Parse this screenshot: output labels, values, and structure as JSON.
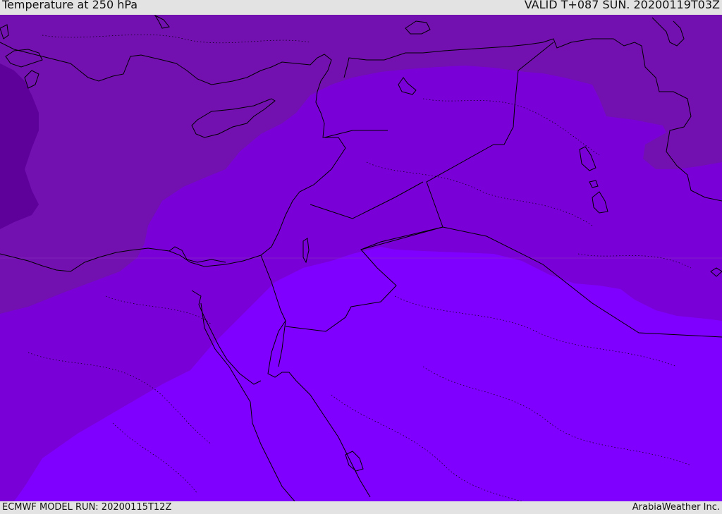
{
  "header": {
    "title": "Temperature at 250 hPa",
    "valid_time": "VALID T+087 SUN. 20200119T03Z"
  },
  "footer": {
    "model_run": "ECMWF MODEL RUN: 20200115T12Z",
    "credit": "ArabiaWeather Inc."
  },
  "colors": {
    "band_darkest": "#5e009a",
    "band_dark": "#7210b0",
    "band_mid": "#7a00d8",
    "band_light": "#7f00ff",
    "coastline": "#000000",
    "header_bg": "#e3e3e3"
  }
}
